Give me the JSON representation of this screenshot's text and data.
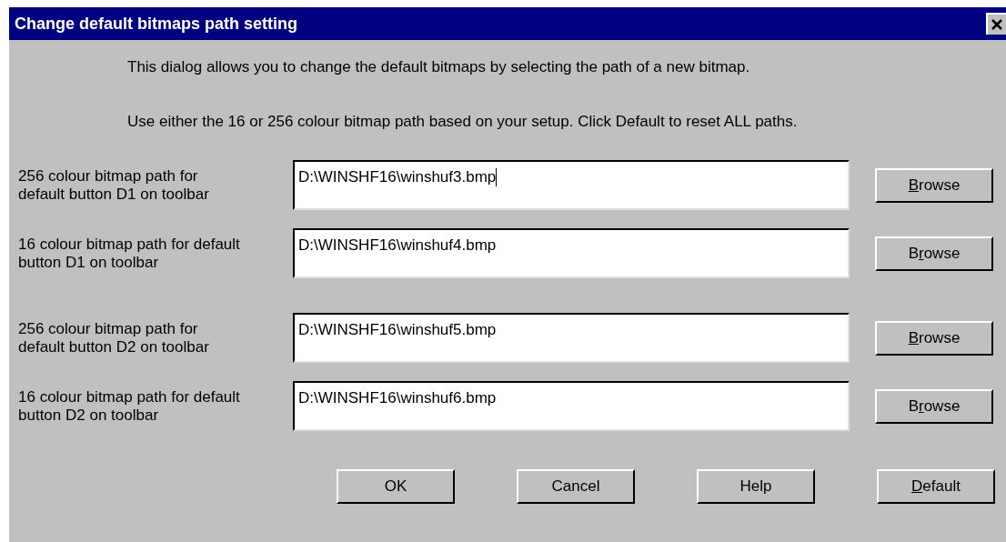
{
  "window": {
    "title": "Change default bitmaps path setting"
  },
  "intro": [
    "This dialog allows you to change the default bitmaps by selecting the path of a new bitmap.",
    "Use  either the 16 or 256 colour bitmap path based on your setup. Click Default to reset ALL paths."
  ],
  "groups": [
    {
      "rows": [
        {
          "label": "256 colour bitmap path for default button D1 on toolbar",
          "value": "D:\\WINSHF16\\winshuf3.bmp",
          "focused": true,
          "button": {
            "key": "B",
            "after": "rowse"
          }
        },
        {
          "label": "16 colour bitmap path for default button D1 on toolbar",
          "value": "D:\\WINSHF16\\winshuf4.bmp",
          "focused": false,
          "button": {
            "before": "B",
            "key": "r",
            "after": "owse"
          }
        }
      ]
    },
    {
      "rows": [
        {
          "label": "256 colour bitmap path for default button D2 on toolbar",
          "value": "D:\\WINSHF16\\winshuf5.bmp",
          "focused": false,
          "button": {
            "key": "B",
            "after": "rowse"
          }
        },
        {
          "label": "16 colour bitmap path for default button D2 on toolbar",
          "value": "D:\\WINSHF16\\winshuf6.bmp",
          "focused": false,
          "button": {
            "before": "B",
            "key": "r",
            "after": "owse"
          }
        }
      ]
    }
  ],
  "buttons": [
    {
      "before": "OK"
    },
    {
      "before": "Cancel"
    },
    {
      "before": "Help"
    },
    {
      "key": "D",
      "after": "efault"
    }
  ]
}
